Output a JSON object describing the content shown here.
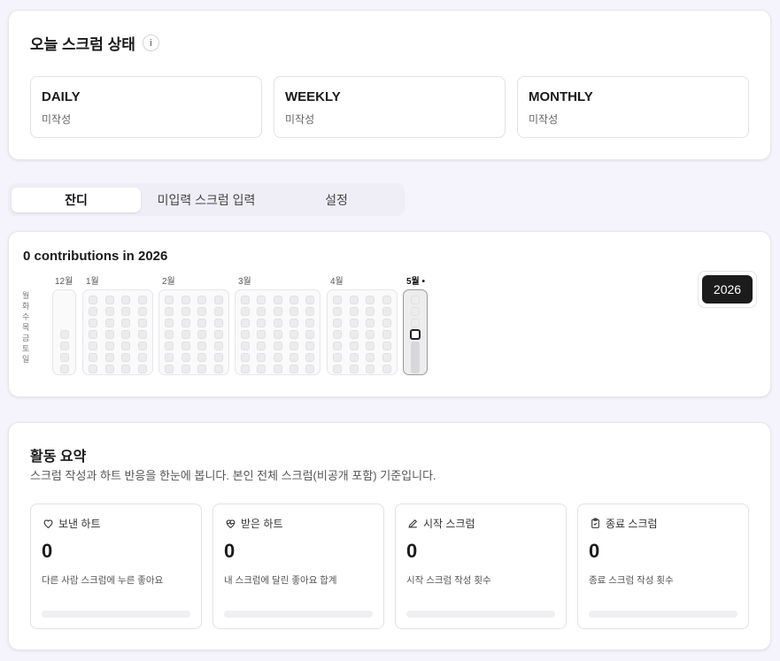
{
  "status": {
    "title": "오늘 스크럼 상태",
    "info_glyph": "i",
    "boxes": [
      {
        "label": "DAILY",
        "state": "미작성"
      },
      {
        "label": "WEEKLY",
        "state": "미작성"
      },
      {
        "label": "MONTHLY",
        "state": "미작성"
      }
    ]
  },
  "tabs": [
    {
      "label": "잔디",
      "active": true
    },
    {
      "label": "미입력 스크럼 입력",
      "active": false
    },
    {
      "label": "설정",
      "active": false
    }
  ],
  "contributions": {
    "title": "0 contributions in 2026",
    "months": [
      "12월",
      "1월",
      "2월",
      "3월",
      "4월",
      "5월 •"
    ],
    "days": [
      "월",
      "화",
      "수",
      "목",
      "금",
      "토",
      "일"
    ],
    "year": "2026"
  },
  "activity": {
    "title": "활동 요약",
    "subtitle": "스크럼 작성과 하트 반응을 한눈에 봅니다. 본인 전체 스크럼(비공개 포함) 기준입니다.",
    "stats": [
      {
        "label": "보낸 하트",
        "icon": "heart-icon",
        "value": "0",
        "desc": "다른 사람 스크럼에 누른 좋아요",
        "progress": 0
      },
      {
        "label": "받은 하트",
        "icon": "heart-pulse-icon",
        "value": "0",
        "desc": "내 스크럼에 달린 좋아요 합계",
        "progress": 0
      },
      {
        "label": "시작 스크럼",
        "icon": "pencil-icon",
        "value": "0",
        "desc": "시작 스크럼 작성 횟수",
        "progress": 0
      },
      {
        "label": "종료 스크럼",
        "icon": "clipboard-icon",
        "value": "0",
        "desc": "종료 스크럼 작성 횟수",
        "progress": 0
      }
    ]
  }
}
